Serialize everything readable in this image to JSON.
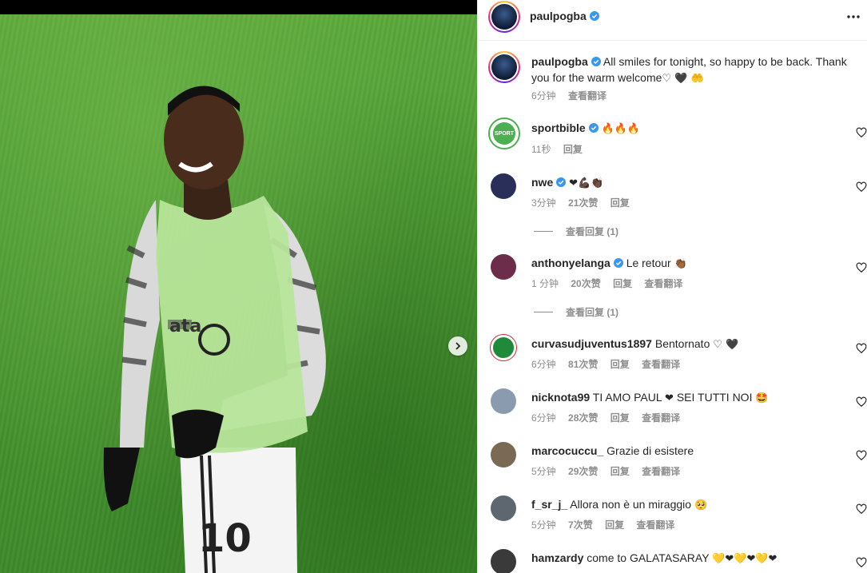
{
  "post": {
    "author": "paulpogba",
    "caption_author": "paulpogba",
    "caption": "All smiles for tonight, so happy to be back. Thank you for the warm welcome",
    "caption_emojis": "♡ 🖤 🤲",
    "caption_time": "6分钟",
    "caption_translate": "查看翻译"
  },
  "comments": [
    {
      "user": "sportbible",
      "verified": true,
      "text": "",
      "emojis": "🔥🔥🔥",
      "time": "11秒",
      "likes": "",
      "reply": "回复",
      "translate": "",
      "avatar_color": "#4caf50"
    },
    {
      "user": "nwe",
      "verified": true,
      "text": "",
      "emojis": "❤💪🏿👏🏿",
      "time": "3分钟",
      "likes": "21次赞",
      "reply": "回复",
      "translate": "",
      "replies": "查看回复 (1)",
      "avatar_color": "#2a2f5a"
    },
    {
      "user": "anthonyelanga",
      "verified": true,
      "text": "Le retour",
      "emojis": "👏🏾",
      "time": "1 分钟",
      "likes": "20次赞",
      "reply": "回复",
      "translate": "查看翻译",
      "replies": "查看回复 (1)",
      "avatar_color": "#6b2d4a"
    },
    {
      "user": "curvasudjuventus1897",
      "verified": false,
      "text": "Bentornato",
      "emojis": "♡ 🖤",
      "time": "6分钟",
      "likes": "81次赞",
      "reply": "回复",
      "translate": "查看翻译",
      "avatar_color": "#1f8a3a"
    },
    {
      "user": "nicknota99",
      "verified": false,
      "text": "TI AMO PAUL",
      "emojis2": "❤",
      "text2": "SEI TUTTI NOI",
      "emojis": "🤩",
      "time": "6分钟",
      "likes": "28次赞",
      "reply": "回复",
      "translate": "查看翻译",
      "avatar_color": "#8a9bb0"
    },
    {
      "user": "marcocuccu_",
      "verified": false,
      "text": "Grazie di esistere",
      "emojis": "",
      "time": "5分钟",
      "likes": "29次赞",
      "reply": "回复",
      "translate": "查看翻译",
      "avatar_color": "#7a6a55"
    },
    {
      "user": "f_sr_j_",
      "verified": false,
      "text": "Allora non è un miraggio",
      "emojis": "🥺",
      "time": "5分钟",
      "likes": "7次赞",
      "reply": "回复",
      "translate": "查看翻译",
      "avatar_color": "#5e6670"
    },
    {
      "user": "hamzardy",
      "verified": false,
      "text": "come to GALATASARAY",
      "emojis": "💛❤💛❤💛❤",
      "time": "",
      "likes": "",
      "reply": "",
      "translate": "",
      "avatar_color": "#3a3a3a"
    }
  ],
  "colors": {
    "verified": "#3897f0",
    "meta": "#8e8e8e"
  }
}
